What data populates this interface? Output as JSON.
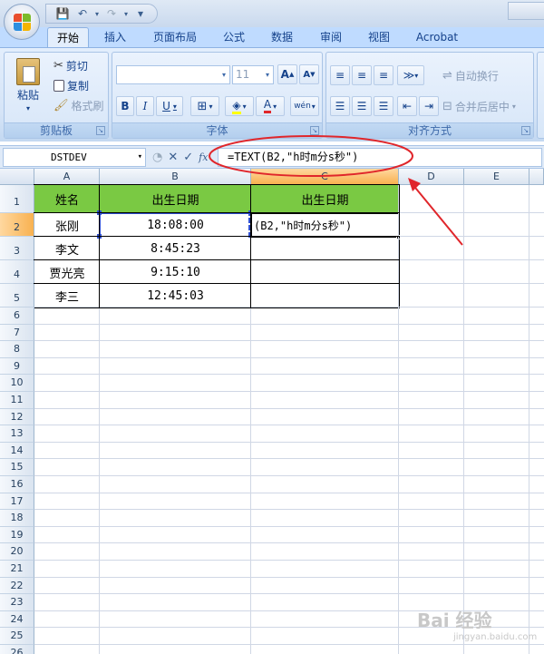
{
  "qat": {
    "save": "💾",
    "undo": "↶",
    "redo": "↷",
    "more": "▾"
  },
  "tabs": [
    {
      "label": "开始",
      "active": true
    },
    {
      "label": "插入"
    },
    {
      "label": "页面布局"
    },
    {
      "label": "公式"
    },
    {
      "label": "数据"
    },
    {
      "label": "审阅"
    },
    {
      "label": "视图"
    },
    {
      "label": "Acrobat"
    }
  ],
  "ribbon": {
    "clipboard": {
      "label": "剪贴板",
      "paste": "粘贴",
      "cut": "剪切",
      "copy": "复制",
      "format_painter": "格式刷"
    },
    "font": {
      "label": "字体",
      "size": "11",
      "grow": "A",
      "shrink": "A",
      "bold": "B",
      "italic": "I",
      "underline": "U",
      "wen": "wén"
    },
    "alignment": {
      "label": "对齐方式",
      "wrap": "自动换行",
      "merge": "合并后居中"
    }
  },
  "formula_bar": {
    "name_box": "DSTDEV",
    "formula": "=TEXT(B2,\"h时m分s秒\")",
    "fx": "fx"
  },
  "columns": [
    "A",
    "B",
    "C",
    "D",
    "E"
  ],
  "rows": [
    "1",
    "2",
    "3",
    "4",
    "5",
    "6",
    "7",
    "8",
    "9",
    "10",
    "11",
    "12",
    "13",
    "14",
    "15",
    "16",
    "17",
    "18",
    "19",
    "20",
    "21",
    "22",
    "23",
    "24",
    "25",
    "26"
  ],
  "table": {
    "header": [
      "姓名",
      "出生日期",
      "出生日期"
    ],
    "rows": [
      [
        "张刚",
        "18:08:00",
        "(B2,\"h时m分s秒\")"
      ],
      [
        "李文",
        "8:45:23",
        ""
      ],
      [
        "贾光亮",
        "9:15:10",
        ""
      ],
      [
        "李三",
        "12:45:03",
        ""
      ]
    ]
  },
  "colors": {
    "header_fill": "#7ac943",
    "annotation": "#e0262b"
  },
  "watermark": {
    "brand": "Bai 经验",
    "url": "jingyan.baidu.com"
  }
}
